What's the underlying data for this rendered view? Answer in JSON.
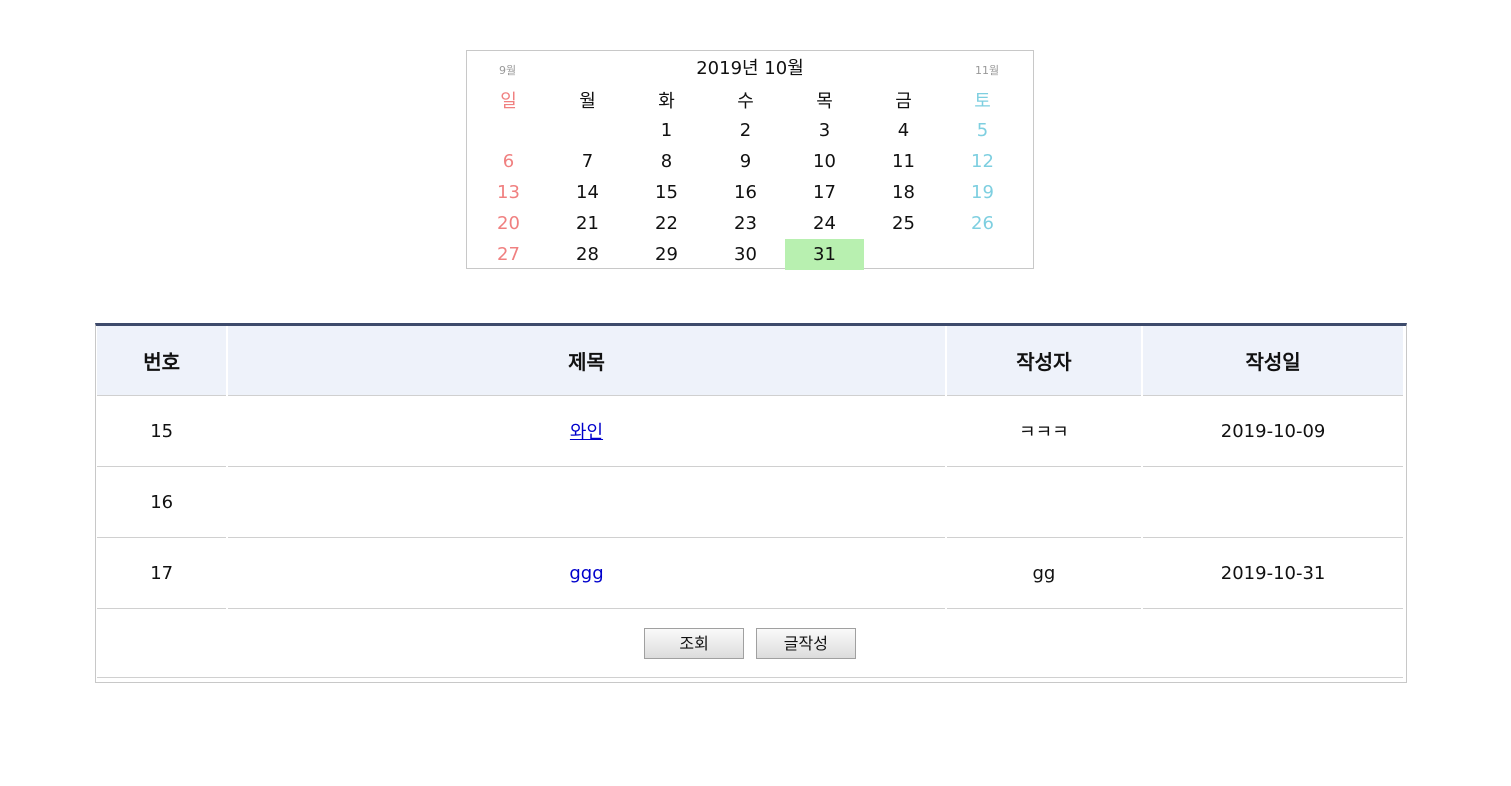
{
  "calendar": {
    "prev_label": "9월",
    "next_label": "11월",
    "title": "2019년 10월",
    "weekdays": [
      "일",
      "월",
      "화",
      "수",
      "목",
      "금",
      "토"
    ],
    "weeks": [
      [
        "",
        "",
        "1",
        "2",
        "3",
        "4",
        "5"
      ],
      [
        "6",
        "7",
        "8",
        "9",
        "10",
        "11",
        "12"
      ],
      [
        "13",
        "14",
        "15",
        "16",
        "17",
        "18",
        "19"
      ],
      [
        "20",
        "21",
        "22",
        "23",
        "24",
        "25",
        "26"
      ],
      [
        "27",
        "28",
        "29",
        "30",
        "31",
        "",
        ""
      ]
    ],
    "today": "31",
    "colors": {
      "sunday": "#f08080",
      "saturday": "#7ecfe0",
      "today_bg": "#b8f0b0"
    }
  },
  "board": {
    "headers": {
      "num": "번호",
      "title": "제목",
      "writer": "작성자",
      "date": "작성일"
    },
    "rows": [
      {
        "num": "15",
        "title": "와인",
        "writer": "ㅋㅋㅋ",
        "date": "2019-10-09"
      },
      {
        "num": "16",
        "title": "",
        "writer": "",
        "date": ""
      },
      {
        "num": "17",
        "title": "ggg",
        "writer": "gg",
        "date": "2019-10-31"
      }
    ],
    "buttons": {
      "view": "조회",
      "write": "글작성"
    },
    "colors": {
      "header_bg": "#eef2fa",
      "top_border": "#3d4a6b",
      "link": "#0000cc"
    }
  }
}
